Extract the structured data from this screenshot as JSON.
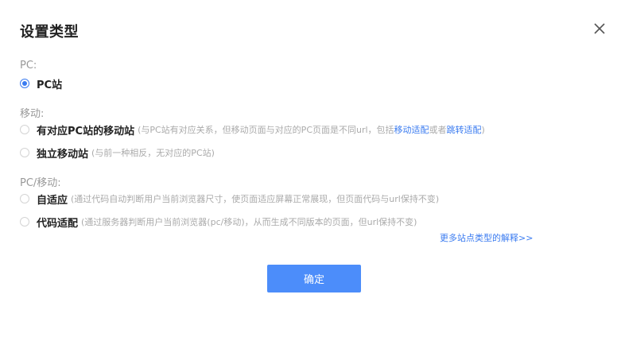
{
  "dialog": {
    "title": "设置类型",
    "close_icon": "close-icon"
  },
  "groups": [
    {
      "label": "PC:",
      "options": [
        {
          "label": "PC站",
          "checked": true
        }
      ]
    },
    {
      "label": "移动:",
      "options": [
        {
          "label": "有对应PC站的移动站",
          "desc_prefix": "(与PC站有对应关系，但移动页面与对应的PC页面是不同url，包括",
          "link1": "移动适配",
          "desc_mid": "或者",
          "link2": "跳转适配",
          "desc_suffix": ")",
          "checked": false
        },
        {
          "label": "独立移动站",
          "desc": "(与前一种相反，无对应的PC站)",
          "checked": false
        }
      ]
    },
    {
      "label": "PC/移动:",
      "options": [
        {
          "label": "自适应",
          "desc": "(通过代码自动判断用户当前浏览器尺寸，使页面适应屏幕正常展现，但页面代码与url保持不变)",
          "checked": false
        },
        {
          "label": "代码适配",
          "desc": "(通过服务器判断用户当前浏览器(pc/移动)，从而生成不同版本的页面，但url保持不变)",
          "checked": false
        }
      ]
    }
  ],
  "more_link": "更多站点类型的解释>>",
  "confirm_label": "确定",
  "colors": {
    "accent": "#4c8dfa",
    "link": "#3a7bf0"
  }
}
